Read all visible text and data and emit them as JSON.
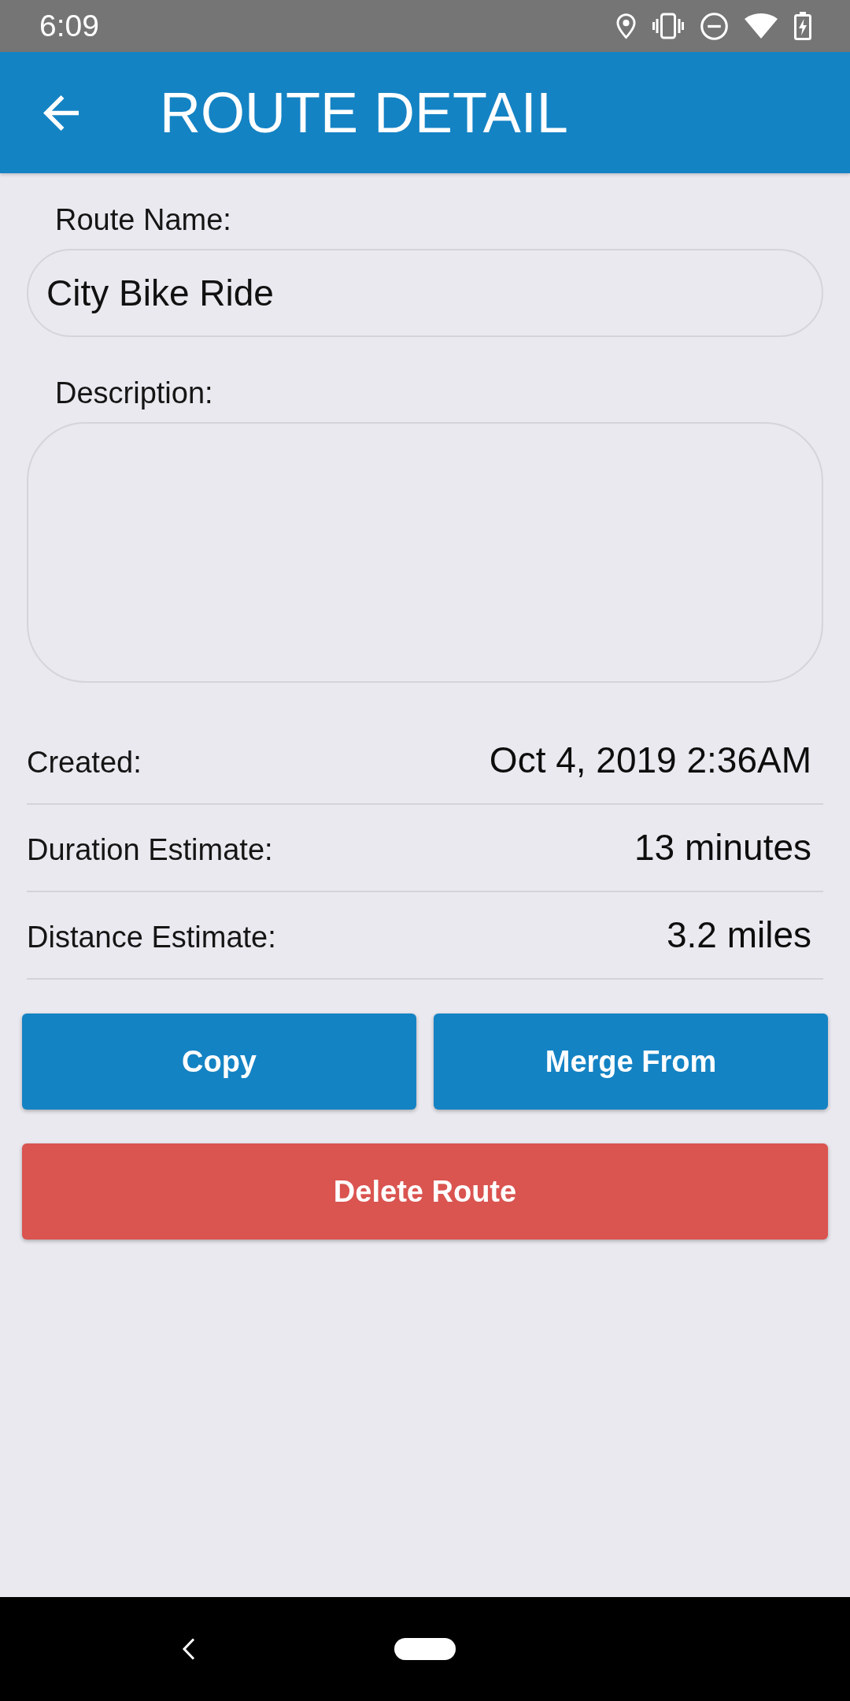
{
  "status_bar": {
    "time": "6:09"
  },
  "app_bar": {
    "title": "ROUTE DETAIL"
  },
  "form": {
    "fields": [
      {
        "kind": "single_line",
        "label": "Route Name:",
        "value": "City Bike Ride"
      },
      {
        "kind": "multi_line",
        "label": "Description:"
      }
    ]
  },
  "details": [
    {
      "label": "Created:",
      "value": "Oct 4, 2019 2:36AM"
    },
    {
      "label": "Duration Estimate:",
      "value": "13 minutes"
    },
    {
      "label": "Distance Estimate:",
      "value": "3.2 miles"
    }
  ],
  "button_rows": [
    [
      {
        "label": "Copy",
        "kind": "primary"
      },
      {
        "label": "Merge From",
        "kind": "primary"
      }
    ],
    [
      {
        "label": "Delete Route",
        "kind": "danger"
      }
    ]
  ]
}
